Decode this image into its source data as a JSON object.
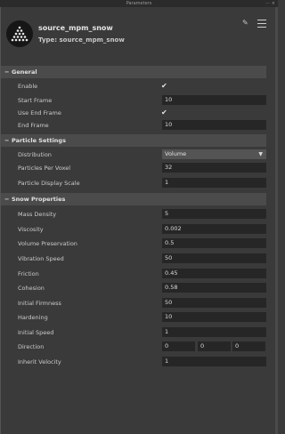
{
  "window": {
    "title": "Parameters"
  },
  "header": {
    "node_name": "source_mpm_snow",
    "node_type": "Type: source_mpm_snow"
  },
  "icons": {
    "pin": "pin-icon",
    "menu": "hamburger-menu-icon",
    "node": "snow-node-icon"
  },
  "sections": {
    "general": {
      "title": "General",
      "collapse": "−",
      "enable_label": "Enable",
      "start_frame_label": "Start Frame",
      "start_frame_value": "10",
      "use_end_frame_label": "Use End Frame",
      "end_frame_label": "End Frame",
      "end_frame_value": "10",
      "check": "✔"
    },
    "particle": {
      "title": "Particle Settings",
      "collapse": "−",
      "distribution_label": "Distribution",
      "distribution_value": "Volume",
      "ppv_label": "Particles Per Voxel",
      "ppv_value": "32",
      "pds_label": "Particle Display Scale",
      "pds_value": "1"
    },
    "snow": {
      "title": "Snow Properties",
      "collapse": "−",
      "mass_density_label": "Mass Density",
      "mass_density_value": "5",
      "viscosity_label": "Viscosity",
      "viscosity_value": "0.002",
      "volume_preservation_label": "Volume Preservation",
      "volume_preservation_value": "0.5",
      "vibration_speed_label": "Vibration Speed",
      "vibration_speed_value": "50",
      "friction_label": "Friction",
      "friction_value": "0.45",
      "cohesion_label": "Cohesion",
      "cohesion_value": "0.58",
      "initial_firmness_label": "Initial Firmness",
      "initial_firmness_value": "50",
      "hardening_label": "Hardening",
      "hardening_value": "10",
      "initial_speed_label": "Initial Speed",
      "initial_speed_value": "1",
      "direction_label": "Direction",
      "direction_x": "0",
      "direction_y": "0",
      "direction_z": "0",
      "inherit_velocity_label": "Inherit Velocity",
      "inherit_velocity_value": "1"
    }
  }
}
